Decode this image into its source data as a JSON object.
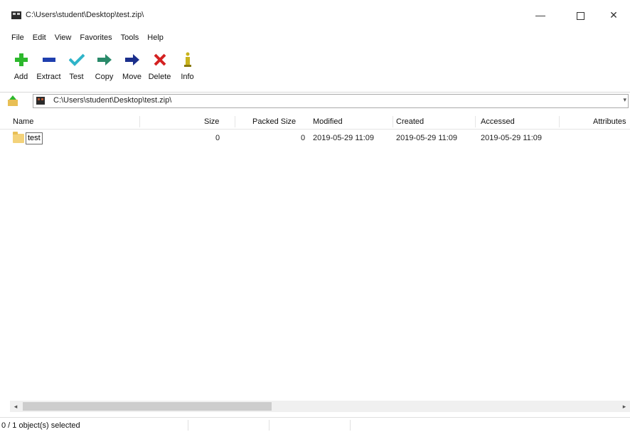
{
  "window": {
    "title": "C:\\Users\\student\\Desktop\\test.zip\\",
    "minimize": "—",
    "close": "✕"
  },
  "menu": [
    "File",
    "Edit",
    "View",
    "Favorites",
    "Tools",
    "Help"
  ],
  "toolbar": [
    {
      "label": "Add",
      "icon": "add-icon",
      "color": "#2db82d"
    },
    {
      "label": "Extract",
      "icon": "extract-icon",
      "color": "#1f3fae"
    },
    {
      "label": "Test",
      "icon": "test-icon",
      "color": "#2fb4c9"
    },
    {
      "label": "Copy",
      "icon": "copy-icon",
      "color": "#2a8a6a"
    },
    {
      "label": "Move",
      "icon": "move-icon",
      "color": "#1b2f8c"
    },
    {
      "label": "Delete",
      "icon": "delete-icon",
      "color": "#d42222"
    },
    {
      "label": "Info",
      "icon": "info-icon",
      "color": "#c9b31c"
    }
  ],
  "address": {
    "path": "C:\\Users\\student\\Desktop\\test.zip\\"
  },
  "columns": [
    "Name",
    "Size",
    "Packed Size",
    "Modified",
    "Created",
    "Accessed",
    "Attributes"
  ],
  "rows": [
    {
      "name": "test",
      "size": "0",
      "packed_size": "0",
      "modified": "2019-05-29 11:09",
      "created": "2019-05-29 11:09",
      "accessed": "2019-05-29 11:09",
      "attributes": ""
    }
  ],
  "status": {
    "text": "0 / 1 object(s) selected"
  }
}
